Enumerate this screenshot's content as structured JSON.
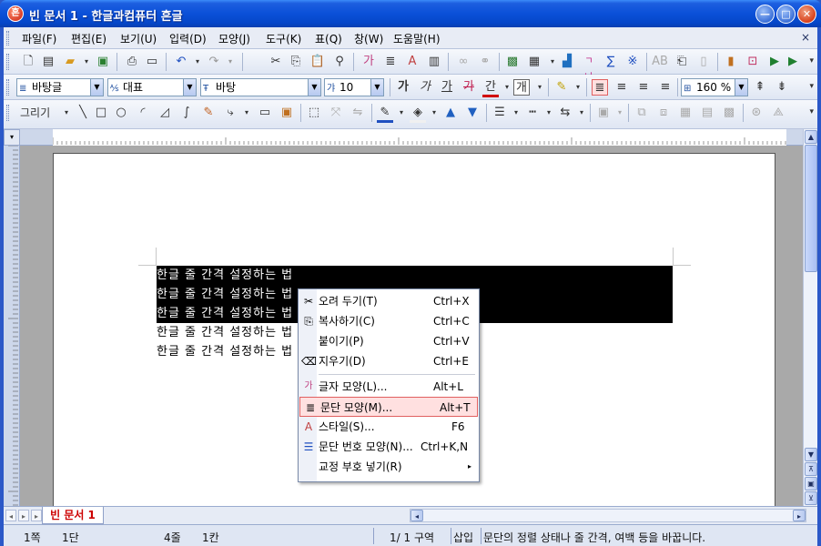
{
  "window": {
    "title": "빈 문서 1 - 한글과컴퓨터 흔글",
    "app_icon_glyph": "흔",
    "min_glyph": "—",
    "max_glyph": "□",
    "close_glyph": "✕"
  },
  "menubar": {
    "items": [
      "파일(F)",
      "편집(E)",
      "보기(U)",
      "입력(D)",
      "모양(J)",
      "도구(K)",
      "표(Q)",
      "창(W)",
      "도움말(H)"
    ],
    "close_glyph": "×"
  },
  "toolbar_format": {
    "style_value": "바탕글",
    "language_value": "대표",
    "font_value": "바탕",
    "size_value": "10",
    "zoom_value": "160 %",
    "bold_label": "가",
    "italic_label": "가",
    "underline_label": "가",
    "strike_label": "가",
    "color_label": "간"
  },
  "toolbar_draw": {
    "draw_label": "그리기"
  },
  "ruler": {
    "corner_glyph": "▾"
  },
  "document": {
    "lines": [
      "한글 줄 간격 설정하는 법",
      "한글 줄 간격 설정하는 법",
      "한글 줄 간격 설정하는 법",
      "한글 줄 간격 설정하는 법",
      "한글 줄 간격 설정하는 법"
    ]
  },
  "context_menu": {
    "items": [
      {
        "label": "오려 두기(T)",
        "shortcut": "Ctrl+X",
        "icon": "scissors-icon",
        "glyph": "✂"
      },
      {
        "label": "복사하기(C)",
        "shortcut": "Ctrl+C",
        "icon": "copy-icon",
        "glyph": "⎘"
      },
      {
        "label": "붙이기(P)",
        "shortcut": "Ctrl+V",
        "icon": "paste-icon",
        "glyph": ""
      },
      {
        "label": "지우기(D)",
        "shortcut": "Ctrl+E",
        "icon": "eraser-icon",
        "glyph": "⌫"
      },
      {
        "label": "글자 모양(L)...",
        "shortcut": "Alt+L",
        "icon": "char-shape-icon",
        "glyph": "가"
      },
      {
        "label": "문단 모양(M)...",
        "shortcut": "Alt+T",
        "icon": "paragraph-icon",
        "glyph": "≣"
      },
      {
        "label": "스타일(S)...",
        "shortcut": "F6",
        "icon": "style-icon",
        "glyph": "A"
      },
      {
        "label": "문단 번호 모양(N)...",
        "shortcut": "Ctrl+K,N",
        "icon": "numbering-icon",
        "glyph": "☰"
      },
      {
        "label": "교정 부호 넣기(R)",
        "shortcut": "",
        "icon": "",
        "glyph": ""
      }
    ],
    "submenu_arrow": "▸"
  },
  "tabs": {
    "active": "빈 문서 1"
  },
  "status": {
    "page": "1쪽",
    "section": "1단",
    "line": "4줄",
    "column": "1칸",
    "pages": "1/  1 구역",
    "mode": "삽입",
    "message": "문단의 정렬 상태나 줄 간격, 여백 등을 바꿉니다."
  },
  "colors": {
    "title_bar": "#0a50d8",
    "highlight": "#ffe0e0",
    "active_tab_text": "#cc0000"
  }
}
